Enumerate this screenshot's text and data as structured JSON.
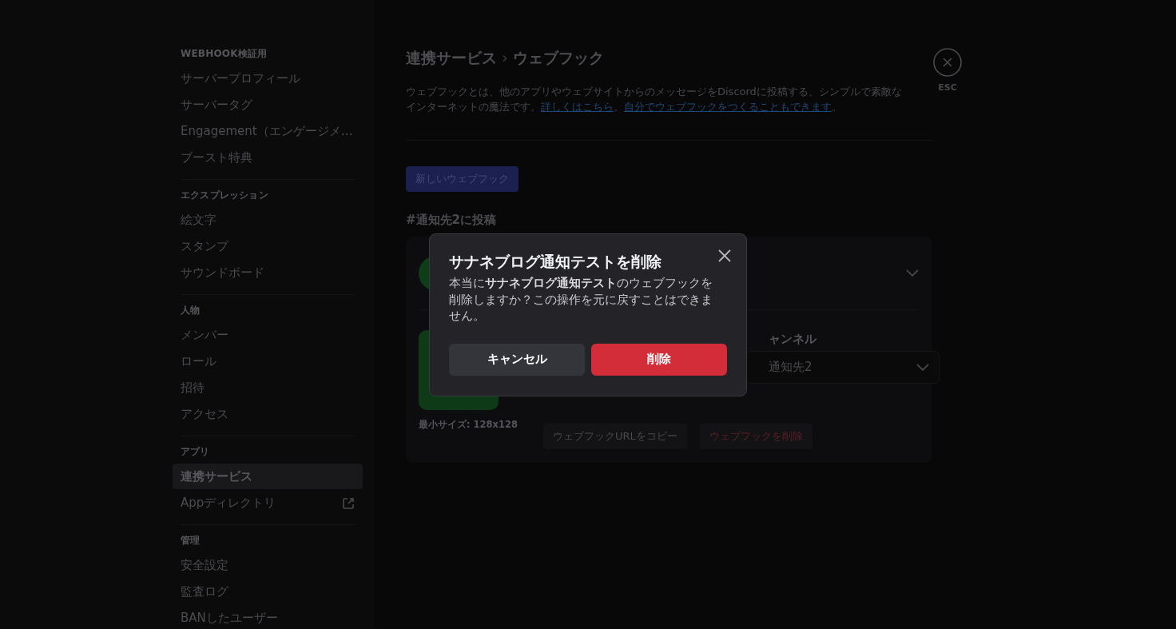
{
  "sidebar": {
    "sections": [
      {
        "header": "WEBHOOK検証用",
        "items": [
          {
            "label": "サーバープロフィール",
            "selected": false,
            "external": false
          },
          {
            "label": "サーバータグ",
            "selected": false,
            "external": false
          },
          {
            "label": "Engagement（エンゲージメ…",
            "selected": false,
            "external": false
          },
          {
            "label": "ブースト特典",
            "selected": false,
            "external": false
          }
        ]
      },
      {
        "header": "エクスプレッション",
        "items": [
          {
            "label": "絵文字",
            "selected": false,
            "external": false
          },
          {
            "label": "スタンプ",
            "selected": false,
            "external": false
          },
          {
            "label": "サウンドボード",
            "selected": false,
            "external": false
          }
        ]
      },
      {
        "header": "人物",
        "items": [
          {
            "label": "メンバー",
            "selected": false,
            "external": false
          },
          {
            "label": "ロール",
            "selected": false,
            "external": false
          },
          {
            "label": "招待",
            "selected": false,
            "external": false
          },
          {
            "label": "アクセス",
            "selected": false,
            "external": false
          }
        ]
      },
      {
        "header": "アプリ",
        "items": [
          {
            "label": "連携サービス",
            "selected": true,
            "external": false
          },
          {
            "label": "Appディレクトリ",
            "selected": false,
            "external": true
          }
        ]
      },
      {
        "header": "管理",
        "items": [
          {
            "label": "安全設定",
            "selected": false,
            "external": false
          },
          {
            "label": "監査ログ",
            "selected": false,
            "external": false
          },
          {
            "label": "BANしたユーザー",
            "selected": false,
            "external": false
          }
        ]
      }
    ]
  },
  "breadcrumb": [
    "連携サービス",
    "ウェブフック"
  ],
  "breadcrumb_separator": "›",
  "description": [
    {
      "kind": "text",
      "text": "ウェブフックとは、他のアプリやウェブサイトからのメッセージをDiscordに投稿する、シンプルで素敵なインターネットの魔法です。"
    },
    {
      "kind": "link",
      "text": "詳しくはこちら"
    },
    {
      "kind": "text",
      "text": "。"
    },
    {
      "kind": "link",
      "text": "自分でウェブフックをつくることもできます"
    },
    {
      "kind": "text",
      "text": "。"
    }
  ],
  "close": {
    "label": "ESC"
  },
  "new_webhook_button": "新しいウェブフック",
  "channel_heading": "#通知先2に投稿",
  "webhook_card": {
    "channel_label": "ャンネル",
    "channel_value": "通知先2",
    "avatar_hint": "最小サイズ: 128x128",
    "copy_button": "ウェブフックURLをコピー",
    "delete_button": "ウェブフックを削除"
  },
  "dialog": {
    "title": "サナネブログ通知テストを削除",
    "body": "本当に**サナネブログ通知テスト**のウェブフックを削除しますか？この操作を元に戻すことはできません。",
    "buttons": [
      {
        "label": "キャンセル",
        "kind": "secondary"
      },
      {
        "label": "削除",
        "kind": "danger"
      }
    ]
  }
}
